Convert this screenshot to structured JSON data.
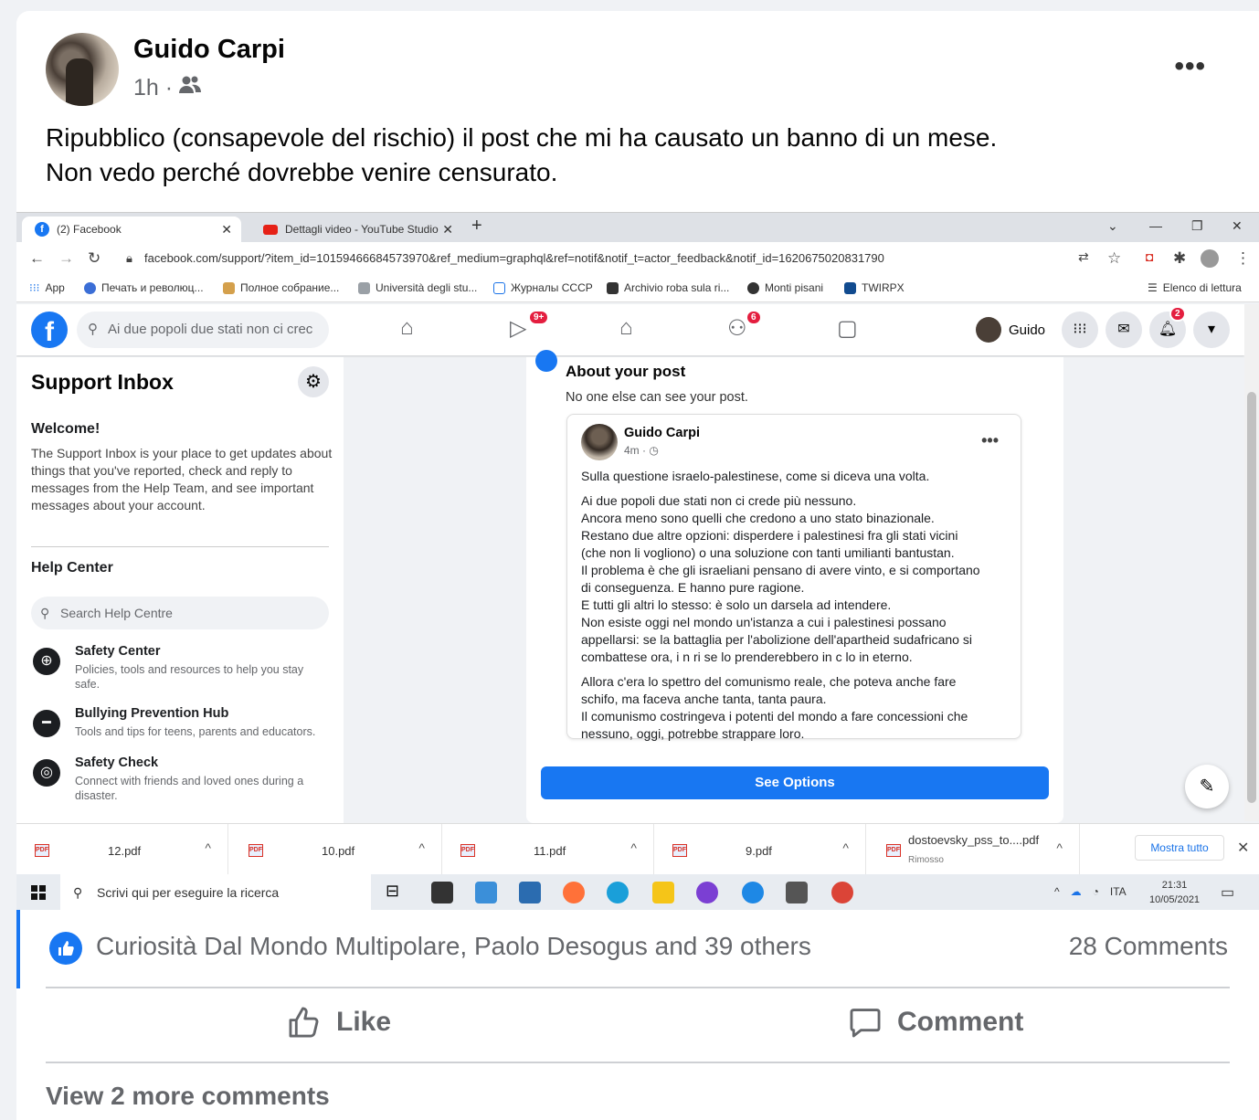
{
  "post": {
    "author": "Guido Carpi",
    "time": "1h ·",
    "text_line1": "Ripubblico (consapevole del rischio) il post che mi ha causato un banno di un mese.",
    "text_line2": "Non vedo perché dovrebbe venire censurato."
  },
  "browser": {
    "tab1": "(2) Facebook",
    "tab2": "Dettagli video - YouTube Studio",
    "url": "facebook.com/support/?item_id=10159466684573970&ref_medium=graphql&ref=notif&notif_t=actor_feedback&notif_id=1620675020831790",
    "bookmarks": [
      "App",
      "Печать и революц...",
      "Полное собрание...",
      "Università degli stu...",
      "Журналы СССР",
      "Archivio roba sula ri...",
      "Monti pisani",
      "TWIRPX"
    ],
    "reading_list": "Elenco di lettura"
  },
  "fb": {
    "search": "Ai due popoli due stati non ci crec",
    "watch_badge": "9+",
    "groups_badge": "6",
    "notif_badge": "2",
    "me": "Guido"
  },
  "support": {
    "title": "Support Inbox",
    "welcome": "Welcome!",
    "welcome_text": "The Support Inbox is your place to get updates about things that you've reported, check and reply to messages from the Help Team, and see important messages about your account.",
    "help_center": "Help Center",
    "help_search": "Search Help Centre",
    "items": [
      {
        "title": "Safety Center",
        "desc": "Policies, tools and resources to help you stay safe."
      },
      {
        "title": "Bullying Prevention Hub",
        "desc": "Tools and tips for teens, parents and educators."
      },
      {
        "title": "Safety Check",
        "desc": "Connect with friends and loved ones during a disaster."
      }
    ]
  },
  "panel": {
    "title": "About your post",
    "subtitle": "No one else can see your post.",
    "inner_author": "Guido Carpi",
    "inner_time": "4m · ◷",
    "p1": "Sulla questione israelo-palestinese, come si diceva una volta.",
    "p2": "Ai due popoli due stati non ci crede più nessuno.\nAncora meno sono quelli che credono a uno stato binazionale.\nRestano due altre opzioni: disperdere i palestinesi fra gli stati vicini\n(che non li vogliono) o una soluzione con tanti umilianti bantustan.\nIl problema è che gli israeliani pensano di avere vinto, e si comportano\ndi conseguenza. E hanno pure ragione.\nE tutti gli altri lo stesso: è solo un darsela ad intendere.\nNon esiste oggi nel mondo un'istanza a cui i palestinesi possano\nappellarsi: se la battaglia per l'abolizione dell'apartheid sudafricano si\ncombattese ora, i n  ri se lo prenderebbero in c  lo in eterno.",
    "p3": "Allora c'era lo spettro del comunismo reale, che poteva anche fare\nschifo, ma faceva anche tanta, tanta paura.\nIl comunismo costringeva i potenti del mondo a fare concessioni che\nnessuno, oggi, potrebbe strappare loro.",
    "button": "See Options"
  },
  "downloads": {
    "files": [
      "12.pdf",
      "10.pdf",
      "11.pdf",
      "9.pdf",
      "dostoevsky_pss_to....pdf"
    ],
    "removed": "Rimosso",
    "show_all": "Mostra tutto"
  },
  "taskbar": {
    "search": "Scrivi qui per eseguire la ricerca",
    "lang": "ITA",
    "time": "21:31",
    "date": "10/05/2021"
  },
  "reactions": {
    "likers": "Curiosità Dal Mondo Multipolare, Paolo Desogus and 39 others",
    "comments": "28 Comments",
    "like": "Like",
    "comment": "Comment",
    "view_more": "View 2 more comments"
  }
}
